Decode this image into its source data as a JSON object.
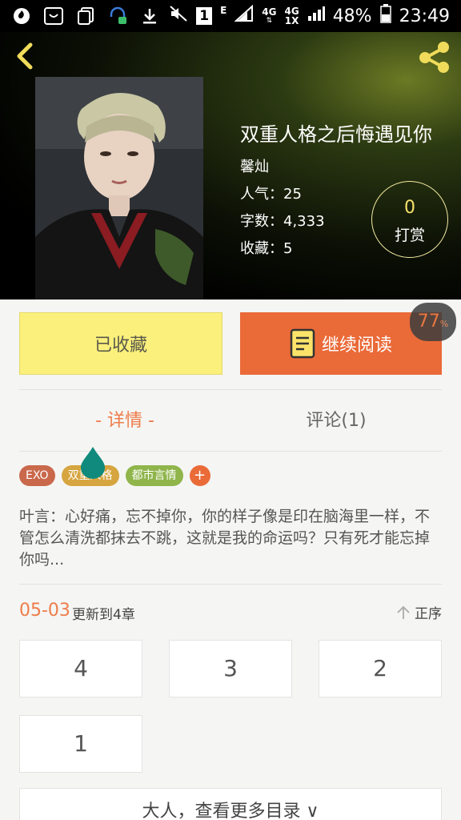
{
  "status_bar": {
    "carrier_sim": "1",
    "net_e": "E",
    "net_4g_1": "4G",
    "net_4g_2": "4G",
    "net_1x": "1X",
    "battery": "48%",
    "time": "23:49"
  },
  "header": {
    "icons": {
      "back": "back-arrow-icon",
      "share": "share-icon"
    },
    "title": "双重人格之后悔遇见你",
    "author": "馨灿",
    "popularity": "人气：25",
    "word_count": "字数：4,333",
    "favorites": "收藏：5",
    "tip_count": "0",
    "tip_label": "打赏"
  },
  "actions": {
    "favorited_label": "已收藏",
    "continue_label": "继续阅读",
    "progress_value": "77",
    "progress_unit": "%"
  },
  "tabs": {
    "detail": "- 详情 -",
    "comment": "评论(1)"
  },
  "tags": [
    {
      "label": "EXO",
      "color": "#c9684b"
    },
    {
      "label": "双重人格",
      "color": "#d6a53f"
    },
    {
      "label": "都市言情",
      "color": "#8fb54b"
    }
  ],
  "tag_add": "+",
  "description": "叶言：心好痛，忘不掉你，你的样子像是印在脑海里一样，不管怎么清洗都抹去不跳，这就是我的命运吗？只有死才能忘掉你吗...",
  "chapters": {
    "update_date": "05-03",
    "update_text": "更新到4章",
    "sort_label": "正序",
    "items": [
      "4",
      "3",
      "2",
      "1"
    ],
    "more_label": "大人，查看更多目录 ∨"
  },
  "colors": {
    "accent": "#ea6a38",
    "favorite_bg": "#fbf07c",
    "tip_number": "#f7e26b"
  }
}
